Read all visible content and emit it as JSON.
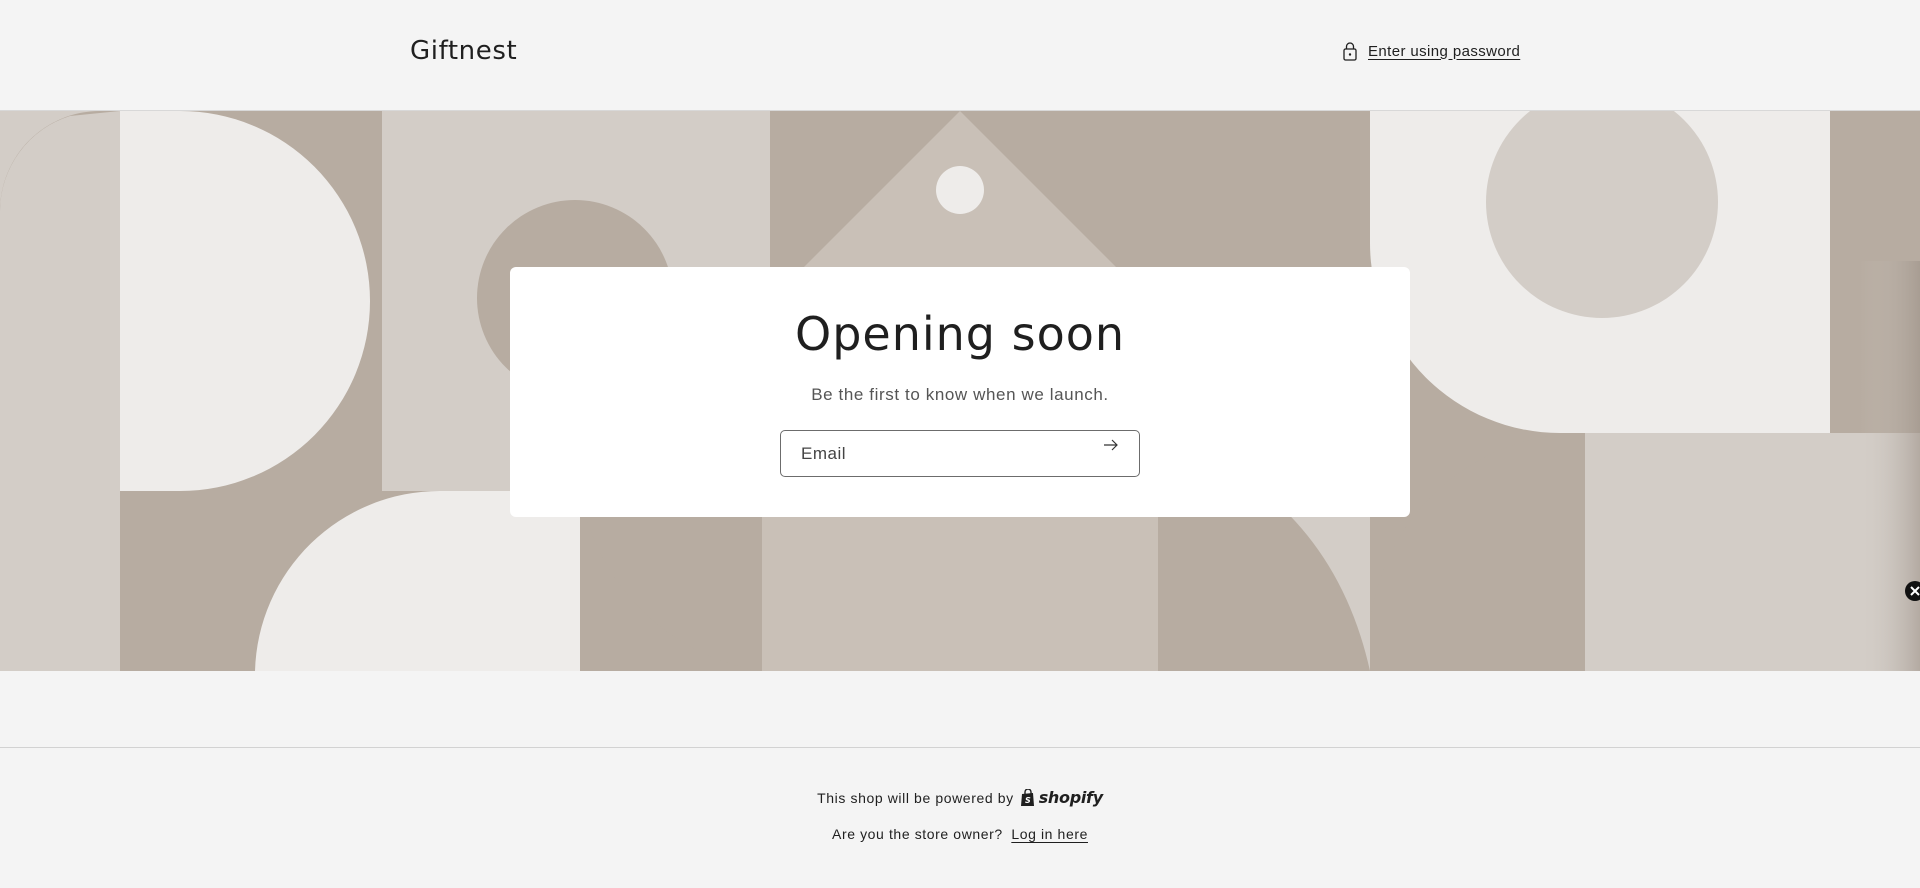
{
  "header": {
    "brand": "Giftnest",
    "password_link": "Enter using password"
  },
  "hero": {
    "colors": {
      "taupe": "#b7aca1",
      "light": "#eeecea",
      "mid": "#d3cdc7",
      "warm": "#c9c0b7"
    }
  },
  "newsletter": {
    "title": "Opening soon",
    "subtitle": "Be the first to know when we launch.",
    "email_placeholder": "Email",
    "submit_icon": "arrow-right-icon"
  },
  "footer": {
    "powered_text": "This shop will be powered by",
    "shopify_logo": "shopify",
    "owner_text": "Are you the store owner?",
    "login_link": "Log in here"
  }
}
